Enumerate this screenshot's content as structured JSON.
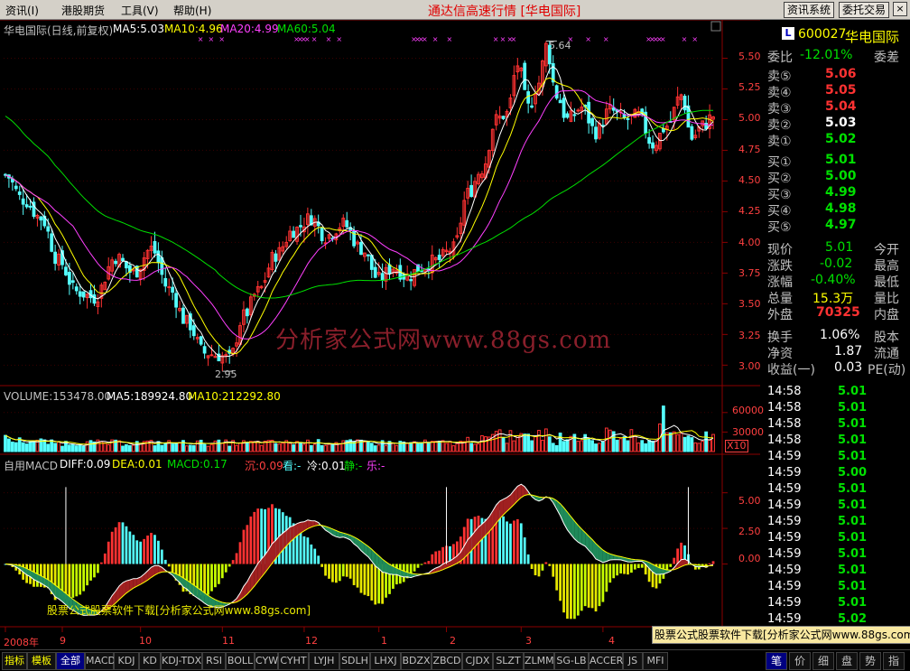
{
  "menus": [
    "资讯(I)",
    "港股期货",
    "工具(V)",
    "帮助(H)"
  ],
  "window_title": "通达信高速行情 [华电国际]",
  "sys_buttons": [
    "资讯系统",
    "委托交易"
  ],
  "win_buttons": [
    "_",
    "□",
    "×"
  ],
  "colors": {
    "up": "#ff3232",
    "down": "#54ffff",
    "ma5": "#ffffff",
    "ma10": "#ffff00",
    "ma20": "#ff40ff",
    "ma60": "#00e000",
    "grid": "#8b0000"
  },
  "chart_data": [
    {
      "type": "candlestick",
      "title": "华电国际(日线,前复权)",
      "legend": [
        {
          "name": "MA5",
          "text": "MA5:5.03"
        },
        {
          "name": "MA10",
          "text": "MA10:4.96"
        },
        {
          "name": "MA20",
          "text": "MA20:4.99"
        },
        {
          "name": "MA60",
          "text": "MA60:5.04"
        }
      ],
      "ylim": [
        2.87,
        5.68
      ],
      "yticks": [
        3.0,
        3.25,
        3.5,
        3.75,
        4.0,
        4.25,
        4.5,
        4.75,
        5.0,
        5.25,
        5.5
      ],
      "ytick_labels": [
        "3.00",
        "3.25",
        "3.50",
        "3.75",
        "4.00",
        "4.25",
        "4.50",
        "4.75",
        "5.00",
        "5.25",
        "5.50"
      ],
      "annotations": [
        {
          "text": "5.64",
          "value": 5.64
        },
        {
          "text": "2.95",
          "value": 2.95
        }
      ],
      "knots": [
        [
          0,
          4.55
        ],
        [
          5,
          4.35
        ],
        [
          10,
          4.2
        ],
        [
          15,
          3.85
        ],
        [
          20,
          3.6
        ],
        [
          25,
          3.55
        ],
        [
          31,
          3.88
        ],
        [
          36,
          3.75
        ],
        [
          41,
          3.95
        ],
        [
          46,
          3.62
        ],
        [
          51,
          3.35
        ],
        [
          56,
          3.1
        ],
        [
          60,
          3.08
        ],
        [
          63,
          3.05
        ],
        [
          67,
          3.4
        ],
        [
          71,
          3.6
        ],
        [
          76,
          3.9
        ],
        [
          81,
          4.1
        ],
        [
          86,
          4.2
        ],
        [
          90,
          4.05
        ],
        [
          95,
          4.15
        ],
        [
          100,
          3.95
        ],
        [
          105,
          3.7
        ],
        [
          109,
          3.8
        ],
        [
          113,
          3.72
        ],
        [
          117,
          3.8
        ],
        [
          121,
          3.85
        ],
        [
          126,
          3.95
        ],
        [
          130,
          4.4
        ],
        [
          134,
          4.6
        ],
        [
          138,
          5.0
        ],
        [
          141,
          5.05
        ],
        [
          144,
          5.45
        ],
        [
          147,
          5.1
        ],
        [
          150,
          5.3
        ],
        [
          152,
          5.6
        ],
        [
          155,
          5.2
        ],
        [
          158,
          5.0
        ],
        [
          162,
          5.1
        ],
        [
          166,
          4.9
        ],
        [
          170,
          5.08
        ],
        [
          174,
          5.0
        ],
        [
          178,
          5.03
        ],
        [
          182,
          4.8
        ],
        [
          186,
          4.95
        ],
        [
          190,
          5.2
        ],
        [
          193,
          4.85
        ],
        [
          196,
          4.95
        ],
        [
          199,
          5.03
        ]
      ],
      "candle_count": 200
    },
    {
      "type": "bar",
      "title": "VOLUME:153478.00",
      "legend": [
        {
          "name": "MA5",
          "text": "MA5:189924.80"
        },
        {
          "name": "MA10",
          "text": "MA10:212292.80"
        }
      ],
      "ylim": [
        0,
        75000
      ],
      "yticks": [
        30000,
        60000
      ],
      "ytick_labels": [
        "30000",
        "60000"
      ],
      "unit_label": "X10"
    },
    {
      "type": "bar",
      "title": "自用MACD",
      "legend": [
        {
          "name": "DIFF",
          "text": "DIFF:0.09"
        },
        {
          "name": "DEA",
          "text": "DEA:0.01"
        },
        {
          "name": "MACD",
          "text": "MACD:0.17"
        },
        {
          "name": "沉",
          "text": "沉:0.09"
        },
        {
          "name": "看",
          "text": "看:-"
        },
        {
          "name": "冷",
          "text": "冷:0.01"
        },
        {
          "name": "静",
          "text": "静:-"
        },
        {
          "name": "乐",
          "text": "乐:-"
        }
      ],
      "ylim": [
        -3.9,
        6.5
      ],
      "yticks": [
        0,
        2.5,
        5
      ],
      "ytick_labels": [
        "0.00",
        "2.50",
        "5.00"
      ]
    }
  ],
  "x_axis": {
    "labels": [
      "2008年",
      "9",
      "10",
      "11",
      "12",
      "1",
      "2",
      "3",
      "4"
    ],
    "positions": [
      0,
      16,
      38,
      61,
      84,
      105,
      124,
      145,
      168
    ]
  },
  "watermark": "分析家公式网www.88gs.com",
  "promo_text": "股票公式股票软件下载[分析家公式网www.88gs.com]",
  "promo_bottom": "股票公式股票软件下载[分析家公式网www.88gs.com]",
  "stock": {
    "code": "600027",
    "name": "华电国际",
    "badge": "L"
  },
  "quote": {
    "weibi": {
      "label": "委比",
      "value": "-12.01%",
      "right": "委差"
    },
    "sell": [
      {
        "label": "卖⑤",
        "price": "5.06"
      },
      {
        "label": "卖④",
        "price": "5.05"
      },
      {
        "label": "卖③",
        "price": "5.04"
      },
      {
        "label": "卖②",
        "price": "5.03"
      },
      {
        "label": "卖①",
        "price": "5.02"
      }
    ],
    "buy": [
      {
        "label": "买①",
        "price": "5.01"
      },
      {
        "label": "买②",
        "price": "5.00"
      },
      {
        "label": "买③",
        "price": "4.99"
      },
      {
        "label": "买④",
        "price": "4.98"
      },
      {
        "label": "买⑤",
        "price": "4.97"
      }
    ],
    "stats": [
      {
        "label": "现价",
        "value": "5.01",
        "right": "今开"
      },
      {
        "label": "涨跌",
        "value": "-0.02",
        "right": "最高"
      },
      {
        "label": "涨幅",
        "value": "-0.40%",
        "right": "最低"
      },
      {
        "label": "总量",
        "value": "15.3万",
        "right": "量比"
      },
      {
        "label": "外盘",
        "value": "70325",
        "right": "内盘"
      }
    ],
    "stats2": [
      {
        "label": "换手",
        "value": "1.06%",
        "right": "股本"
      },
      {
        "label": "净资",
        "value": "1.87",
        "right": "流通"
      },
      {
        "label": "收益(一)",
        "value": "0.03",
        "right": "PE(动)"
      }
    ]
  },
  "ticks": [
    {
      "time": "14:58",
      "price": "5.01"
    },
    {
      "time": "14:58",
      "price": "5.01"
    },
    {
      "time": "14:58",
      "price": "5.01"
    },
    {
      "time": "14:58",
      "price": "5.01"
    },
    {
      "time": "14:59",
      "price": "5.01"
    },
    {
      "time": "14:59",
      "price": "5.00"
    },
    {
      "time": "14:59",
      "price": "5.01"
    },
    {
      "time": "14:59",
      "price": "5.01"
    },
    {
      "time": "14:59",
      "price": "5.01"
    },
    {
      "time": "14:59",
      "price": "5.01"
    },
    {
      "time": "14:59",
      "price": "5.01"
    },
    {
      "time": "14:59",
      "price": "5.01"
    },
    {
      "time": "14:59",
      "price": "5.01"
    },
    {
      "time": "14:59",
      "price": "5.01"
    },
    {
      "time": "14:59",
      "price": "5.02"
    }
  ],
  "bottom_tabs": [
    "指标",
    "模板",
    "全部",
    "MACD",
    "KDJ",
    "KD",
    "KDJ-TDX",
    "RSI",
    "BOLL",
    "CYW",
    "CYHT",
    "LYJH",
    "SDLH",
    "LHXJ",
    "BDZX",
    "ZBCD",
    "CJDX",
    "SLZT",
    "ZLMM",
    "SG-LB",
    "ACCER",
    "JS",
    "MFI"
  ],
  "right_tabs": [
    "笔",
    "价",
    "细",
    "盘",
    "势",
    "指"
  ]
}
